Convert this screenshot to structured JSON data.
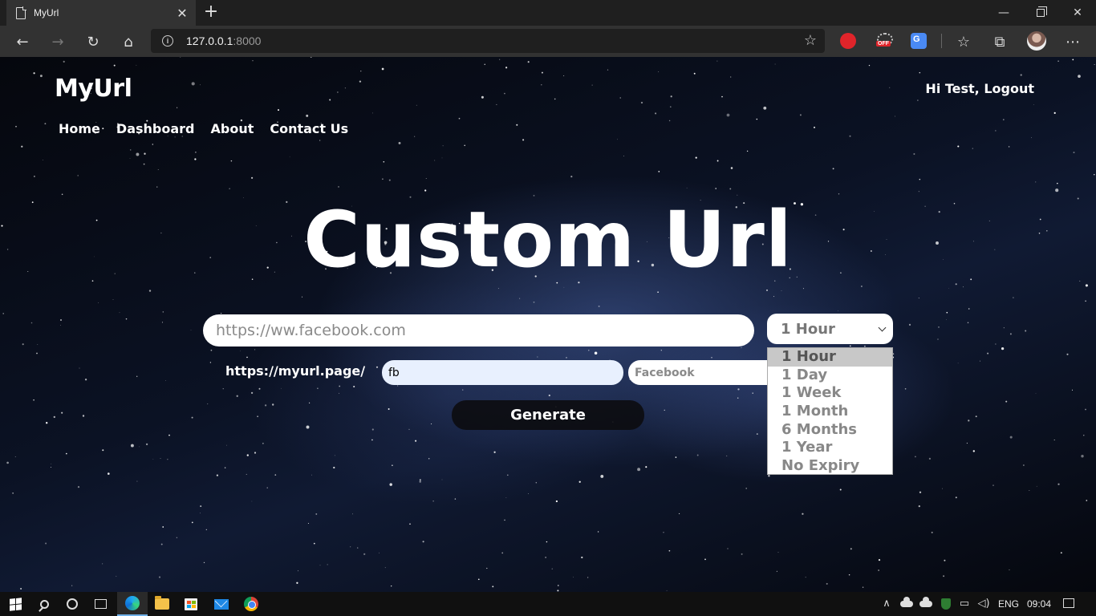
{
  "browser": {
    "tab_title": "MyUrl",
    "url_host": "127.0.0.1",
    "url_port": ":8000"
  },
  "page": {
    "brand": "MyUrl",
    "greeting": "Hi Test, Logout",
    "nav": [
      "Home",
      "Dashboard",
      "About",
      "Contact Us"
    ],
    "hero_title": "Custom Url",
    "long_url_placeholder": "https://ww.facebook.com",
    "expiry": {
      "selected": "1 Hour",
      "options": [
        "1 Hour",
        "1 Day",
        "1 Week",
        "1 Month",
        "6 Months",
        "1 Year",
        "No Expiry"
      ]
    },
    "prefix": "https://myurl.page/",
    "alias_value": "fb",
    "title_placeholder": "Facebook",
    "generate_label": "Generate"
  },
  "taskbar": {
    "language": "ENG",
    "time": "09:04"
  },
  "colors": {
    "alias_bg": "#e8f0fe",
    "option_selected_bg": "#c8c8c8",
    "generate_bg": "#0c0c10"
  }
}
